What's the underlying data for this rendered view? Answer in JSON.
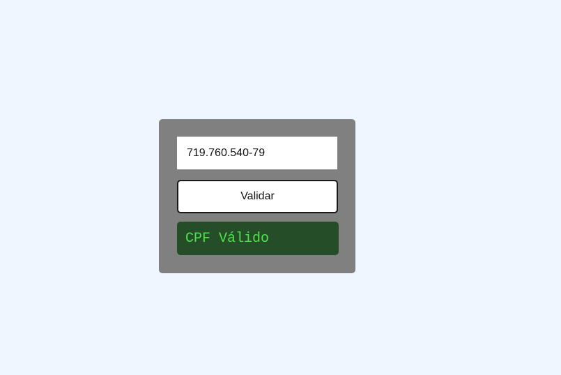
{
  "form": {
    "cpf_value": "719.760.540-79",
    "validate_label": "Validar",
    "result_text": "CPF Válido"
  },
  "colors": {
    "page_background": "#eef6ff",
    "card_background": "#808080",
    "result_background": "#254d27",
    "result_text": "#4ee24e"
  }
}
